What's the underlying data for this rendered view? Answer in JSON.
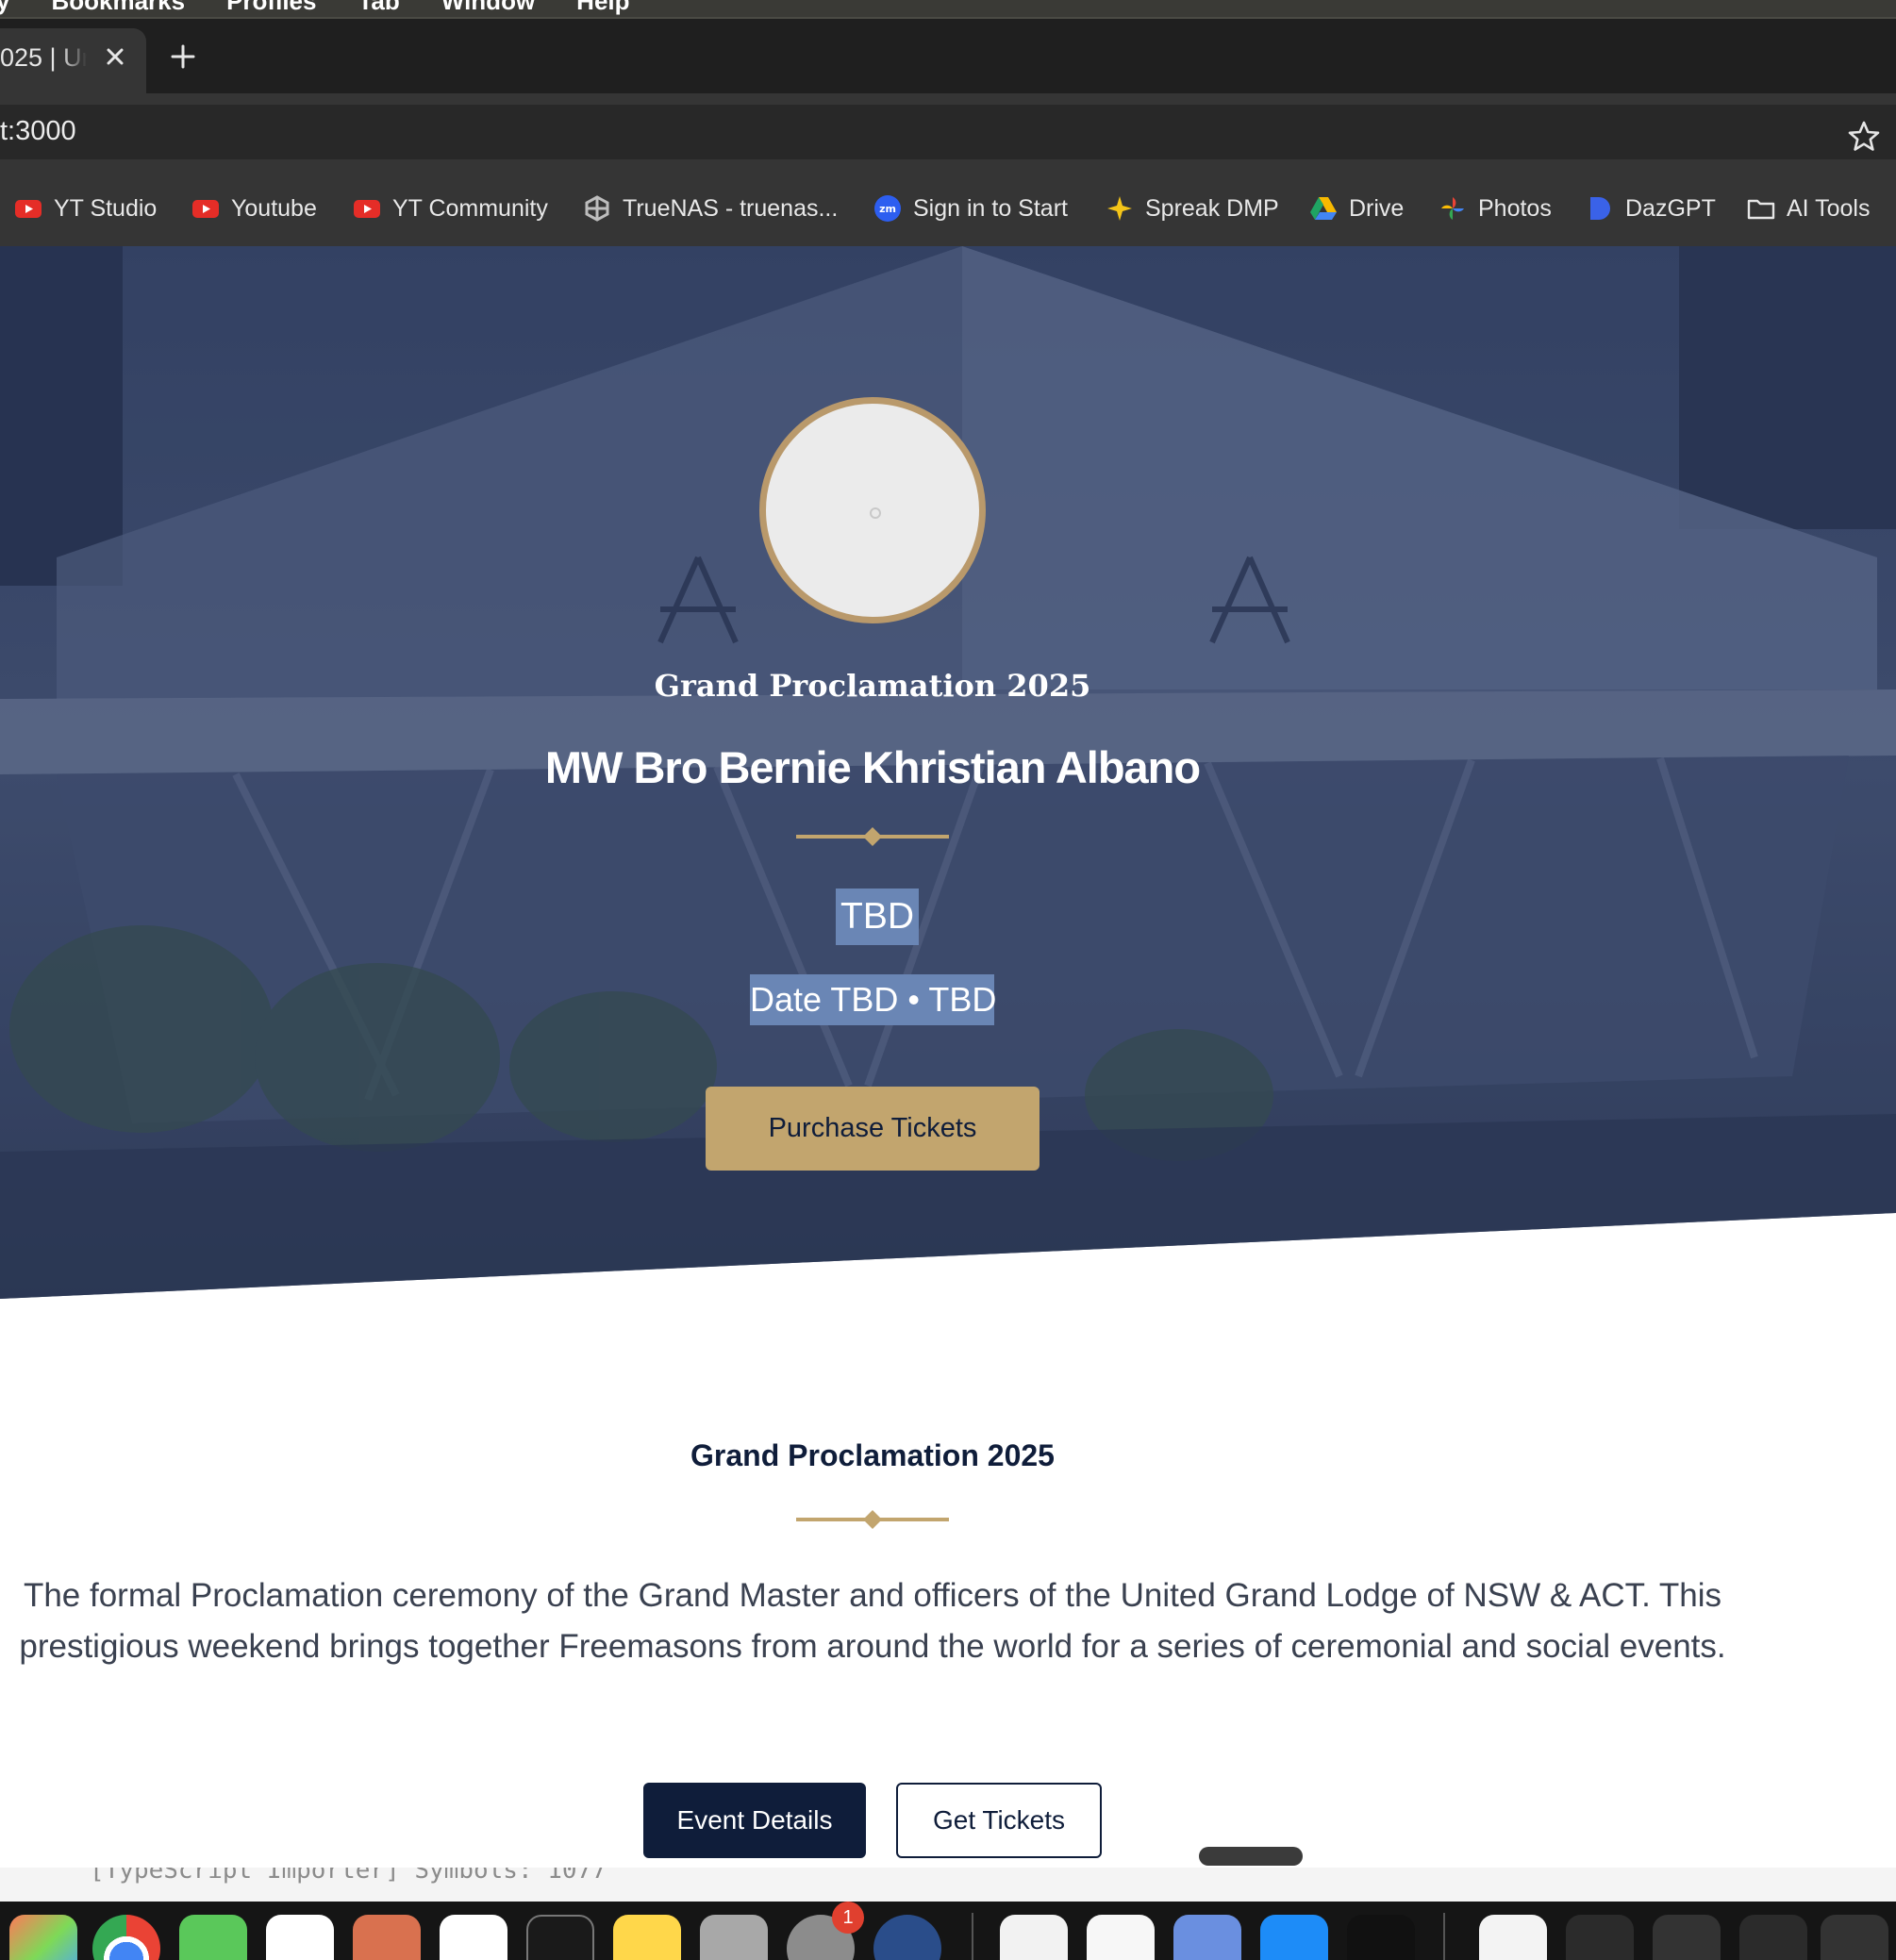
{
  "menubar": {
    "items": [
      "y",
      "Bookmarks",
      "Profiles",
      "Tab",
      "Window",
      "Help"
    ]
  },
  "browser": {
    "tab_title": "025 | Ur",
    "address": "t:3000",
    "bookmarks": [
      {
        "label": "YT Studio",
        "icon": "youtube-icon"
      },
      {
        "label": "Youtube",
        "icon": "youtube-icon"
      },
      {
        "label": "YT Community",
        "icon": "youtube-icon"
      },
      {
        "label": "TrueNAS - truenas...",
        "icon": "truenas-icon"
      },
      {
        "label": "Sign in to Start",
        "icon": "zoom-icon"
      },
      {
        "label": "Spreak DMP",
        "icon": "sparkle-icon"
      },
      {
        "label": "Drive",
        "icon": "drive-icon"
      },
      {
        "label": "Photos",
        "icon": "photos-icon"
      },
      {
        "label": "DazGPT",
        "icon": "dazgpt-icon"
      },
      {
        "label": "AI Tools",
        "icon": "folder-icon"
      }
    ]
  },
  "hero": {
    "subtitle": "Grand Proclamation 2025",
    "title": "MW Bro Bernie Khristian Albano",
    "venue": "TBD",
    "date_line": "Date TBD • TBD",
    "cta": "Purchase Tickets"
  },
  "content": {
    "title": "Grand Proclamation 2025",
    "description": "The formal Proclamation ceremony of the Grand Master and officers of the United Grand Lodge of NSW & ACT. This prestigious weekend brings together Freemasons from around the world for a series of ceremonial and social events.",
    "primary_button": "Event Details",
    "secondary_button": "Get Tickets"
  },
  "terminal": {
    "text": "[TypeScript Importer] Symbols: 1077"
  },
  "dock": {
    "badge_count": "1"
  },
  "colors": {
    "navy": "#0f1d3a",
    "gold": "#c2a56e",
    "selection": "#6a86b5"
  }
}
